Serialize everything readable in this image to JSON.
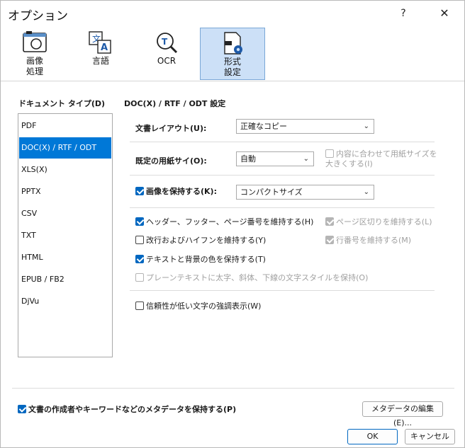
{
  "window": {
    "title": "オプション",
    "help_label": "?",
    "close_label": "✕"
  },
  "toolbar": {
    "items": [
      {
        "label": "画像\n処理",
        "icon": "camera-icon"
      },
      {
        "label": "言語",
        "icon": "language-icon"
      },
      {
        "label": "OCR",
        "icon": "ocr-icon"
      },
      {
        "label": "形式\n設定",
        "icon": "format-settings-icon",
        "active": true
      }
    ]
  },
  "doc_types": {
    "label": "ドキュメント タイプ(D)",
    "items": [
      "PDF",
      "DOC(X) / RTF / ODT",
      "XLS(X)",
      "PPTX",
      "CSV",
      "TXT",
      "HTML",
      "EPUB / FB2",
      "DjVu"
    ],
    "selected": "DOC(X) / RTF / ODT"
  },
  "settings": {
    "title": "DOC(X) / RTF / ODT 設定",
    "layout_label": "文書レイアウト(U):",
    "layout_value": "正確なコピー",
    "paper_label": "既定の用紙サイ(O):",
    "paper_value": "自動",
    "fit_paper": "内容に合わせて用紙サイズを大きくする(I)",
    "keep_images": "画像を保持する(K):",
    "image_value": "コンパクトサイズ",
    "keep_headers": "ヘッダー、フッター、ページ番号を維持する(H)",
    "keep_page_breaks": "ページ区切りを維持する(L)",
    "keep_line_breaks": "改行およびハイフンを維持する(Y)",
    "keep_line_numbers": "行番号を維持する(M)",
    "keep_colors": "テキストと背景の色を保持する(T)",
    "keep_styles": "プレーンテキストに太字、斜体、下線の文字スタイルを保持(O)",
    "highlight_uncertain": "信頼性が低い文字の強調表示(W)"
  },
  "footer": {
    "keep_metadata": "文書の作成者やキーワードなどのメタデータを保持する(P)",
    "edit_metadata": "メタデータの編集(E)...",
    "ok": "OK",
    "cancel": "キャンセル"
  },
  "colors": {
    "accent": "#0078d7",
    "checkbox": "#0067c0",
    "active_tool": "#cce0f7"
  }
}
